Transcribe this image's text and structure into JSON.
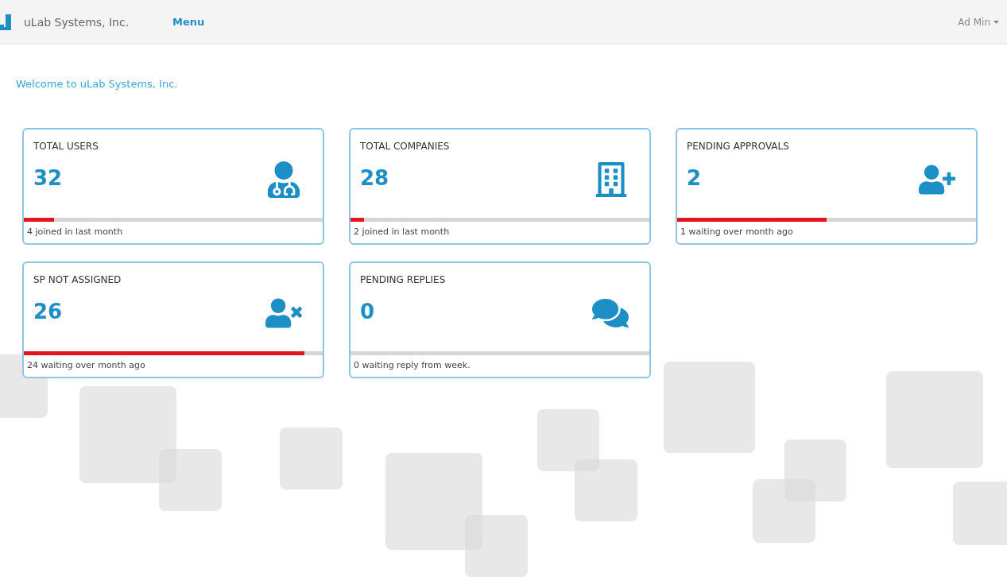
{
  "header": {
    "brand": "uLab Systems, Inc.",
    "menu": "Menu",
    "user": "Ad Min"
  },
  "welcome": "Welcome to uLab Systems, Inc.",
  "cards": [
    {
      "title": "TOTAL USERS",
      "value": "32",
      "kind": "doctor",
      "level": 0.1,
      "footer": "4 joined in last month"
    },
    {
      "title": "TOTAL COMPANIES",
      "value": "28",
      "kind": "building",
      "level": 0.045,
      "footer": "2 joined in last month"
    },
    {
      "title": "PENDING APPROVALS",
      "value": "2",
      "kind": "user-plus",
      "level": 0.5,
      "footer": "1 waiting over month ago"
    },
    {
      "title": "SP NOT ASSIGNED",
      "value": "26",
      "kind": "user-x",
      "level": 0.94,
      "footer": "24 waiting over month ago"
    },
    {
      "title": "PENDING REPLIES",
      "value": "0",
      "kind": "chat",
      "footer": "0 waiting reply from week."
    }
  ]
}
